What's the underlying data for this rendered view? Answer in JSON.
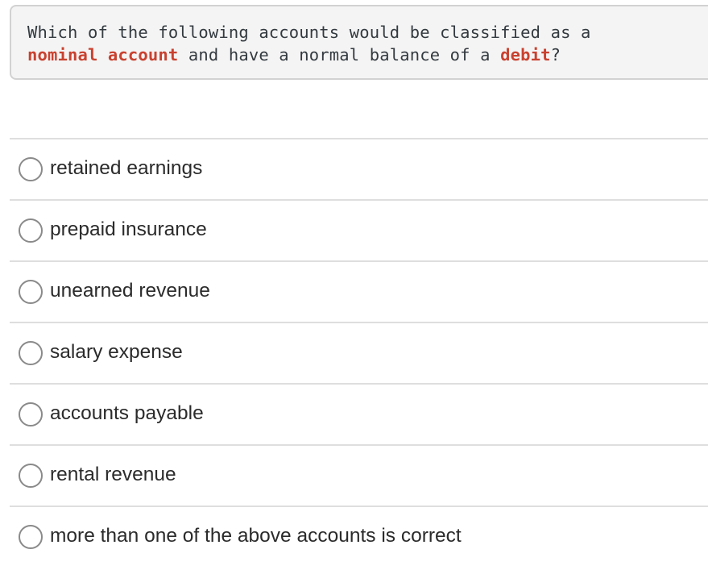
{
  "question": {
    "line1_plain": "Which of the following accounts would be classified as a",
    "line2_highlight1": "nominal account",
    "line2_plain1": " and have a normal balance of a ",
    "line2_highlight2": "debit",
    "line2_plain2": "?"
  },
  "options": [
    {
      "label": "retained earnings",
      "selected": false
    },
    {
      "label": "prepaid insurance",
      "selected": false
    },
    {
      "label": "unearned revenue",
      "selected": false
    },
    {
      "label": "salary expense",
      "selected": false
    },
    {
      "label": "accounts payable",
      "selected": false
    },
    {
      "label": "rental revenue",
      "selected": false
    },
    {
      "label": "more than one of the above accounts is correct",
      "selected": false
    }
  ],
  "colors": {
    "highlight": "#c9412f",
    "question_bg": "#f4f4f4",
    "divider": "#dedede",
    "radio_border": "#8a8a8a"
  }
}
